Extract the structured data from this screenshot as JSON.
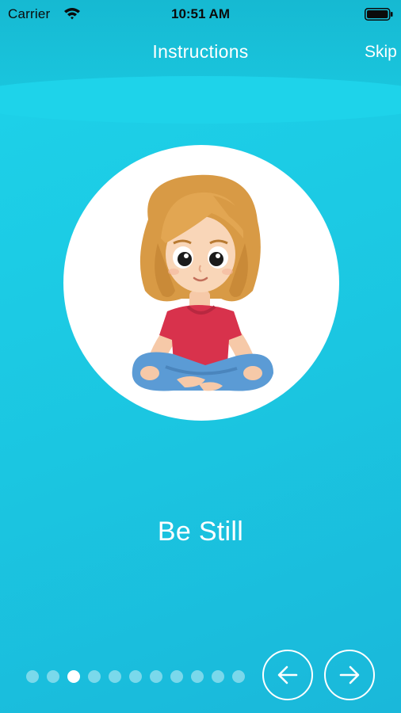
{
  "status_bar": {
    "carrier": "Carrier",
    "time": "10:51 AM",
    "wifi_icon": "wifi-icon",
    "battery_icon": "battery-icon"
  },
  "nav": {
    "title": "Instructions",
    "skip_label": "Skip"
  },
  "slide": {
    "illustration": "girl-sitting-cross-legged",
    "caption": "Be Still"
  },
  "pager": {
    "total": 11,
    "current": 3
  },
  "controls": {
    "prev_icon": "arrow-left-icon",
    "next_icon": "arrow-right-icon"
  },
  "colors": {
    "background": "#1ec8e3",
    "header": "#16b9d2",
    "text": "#ffffff",
    "dot_inactive": "rgba(255,255,255,0.42)",
    "dot_active": "#ffffff"
  }
}
